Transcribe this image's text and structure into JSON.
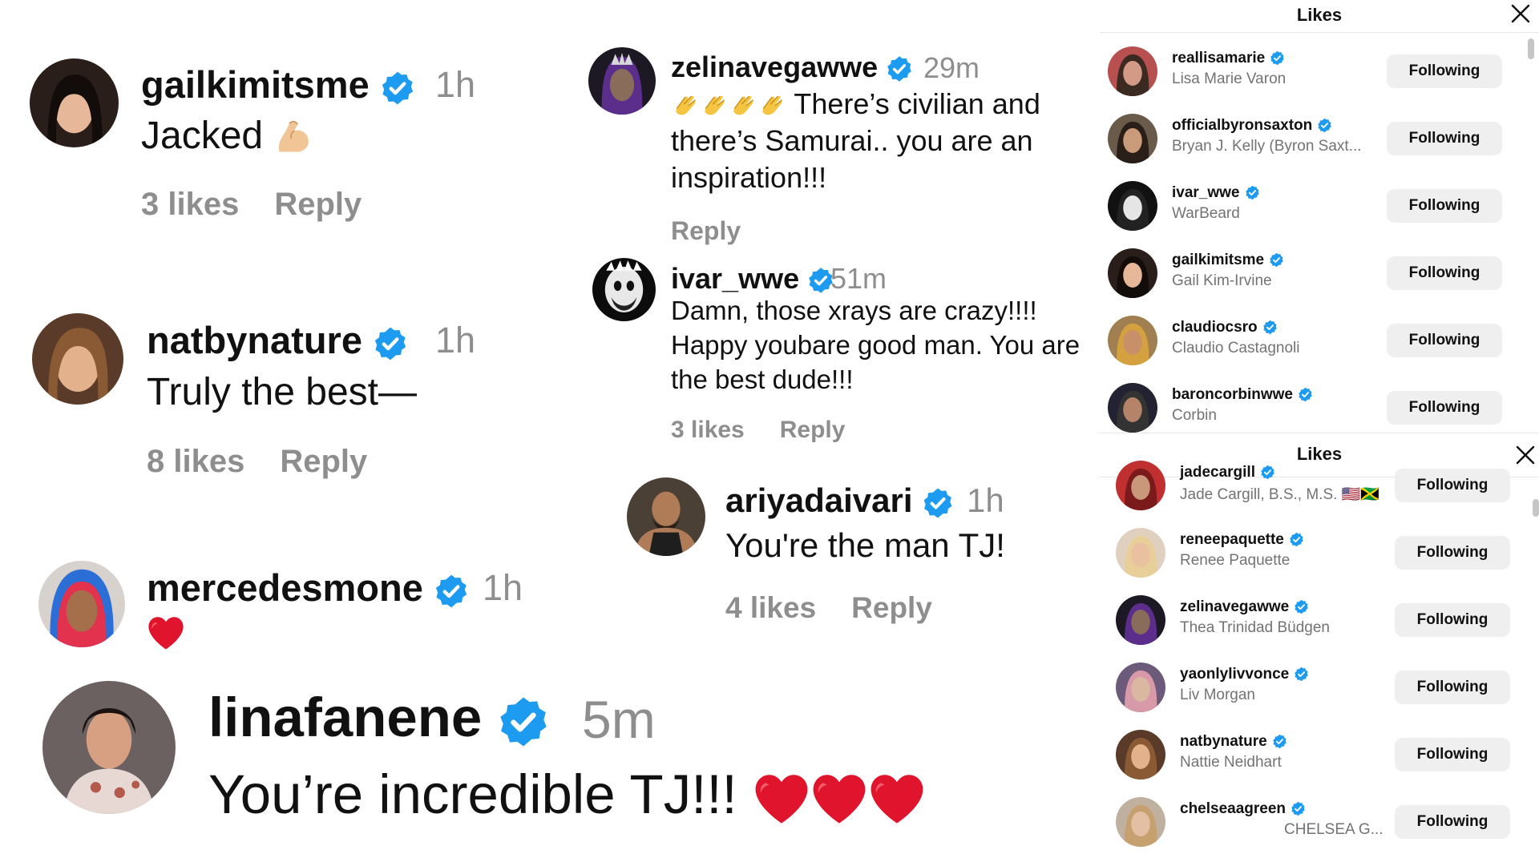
{
  "comments": [
    {
      "username": "gailkimitsme",
      "time": "1h",
      "text": "Jacked",
      "emoji": "flexed-biceps",
      "likes": "3 likes",
      "reply": "Reply"
    },
    {
      "username": "natbynature",
      "time": "1h",
      "text": "Truly the best—",
      "likes": "8 likes",
      "reply": "Reply"
    },
    {
      "username": "mercedesmone",
      "time": "1h",
      "emoji": "red-heart"
    },
    {
      "username": "linafanene",
      "time": "5m",
      "text": "You’re incredible TJ!!!",
      "emoji": "three-red-hearts"
    },
    {
      "username": "zelinavegawwe",
      "time": "29m",
      "line1": "There’s civilian and",
      "line2": "there’s Samurai.. you are an",
      "line3": "inspiration!!!",
      "emoji": "four-clapping-hands",
      "reply": "Reply"
    },
    {
      "username": "ivar_wwe",
      "time": "51m",
      "line1": "Damn, those xrays are crazy!!!!",
      "line2": "Happy youbare good man. You are",
      "line3": "the best dude!!!",
      "likes": "3 likes",
      "reply": "Reply"
    },
    {
      "username": "ariyadaivari",
      "time": "1h",
      "text": "You're the man TJ!",
      "likes": "4 likes",
      "reply": "Reply"
    }
  ],
  "likes_panel_1": {
    "title": "Likes",
    "users": [
      {
        "username": "reallisamarie",
        "name": "Lisa Marie Varon",
        "button": "Following"
      },
      {
        "username": "officialbyronsaxton",
        "name": "Bryan J. Kelly (Byron Saxt...",
        "button": "Following"
      },
      {
        "username": "ivar_wwe",
        "name": "WarBeard",
        "button": "Following"
      },
      {
        "username": "gailkimitsme",
        "name": "Gail Kim-Irvine",
        "button": "Following"
      },
      {
        "username": "claudiocsro",
        "name": "Claudio Castagnoli",
        "button": "Following"
      },
      {
        "username": "baroncorbinwwe",
        "name": "Corbin",
        "button": "Following"
      }
    ]
  },
  "likes_panel_2": {
    "title": "Likes",
    "users": [
      {
        "username": "jadecargill",
        "name": "Jade Cargill, B.S., M.S. 🇺🇸🇯🇲",
        "button": "Following"
      },
      {
        "username": "reneepaquette",
        "name": "Renee Paquette",
        "button": "Following"
      },
      {
        "username": "zelinavegawwe",
        "name": "Thea Trinidad Büdgen",
        "button": "Following"
      },
      {
        "username": "yaonlylivvonce",
        "name": "Liv Morgan",
        "button": "Following"
      },
      {
        "username": "natbynature",
        "name": "Nattie Neidhart",
        "button": "Following"
      },
      {
        "username": "chelseaagreen",
        "name": "CHELSEA G...",
        "button": "Following"
      }
    ]
  },
  "colors": {
    "verified": "#1d9bf0",
    "muted": "#8e8e8e",
    "button_bg": "#efefef",
    "heart": "#e0142c"
  },
  "icons": {
    "verified": "verified-badge-icon",
    "close": "close-icon"
  }
}
